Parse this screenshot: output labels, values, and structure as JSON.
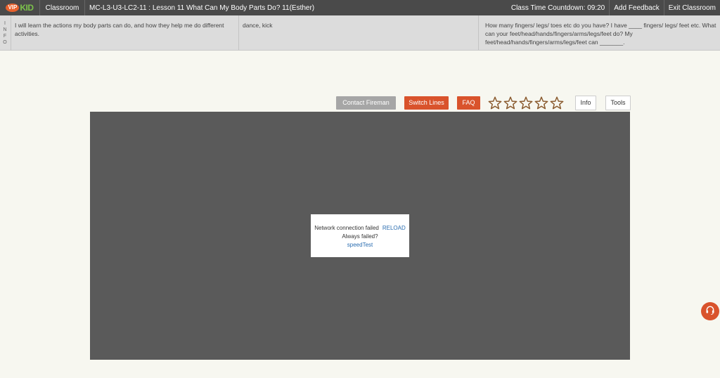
{
  "topbar": {
    "logo_vip": "VIP",
    "logo_kid": "KID",
    "classroom": "Classroom",
    "lesson": "MC-L3-U3-LC2-11 : Lesson 11 What Can My Body Parts Do? 11(Esther)",
    "countdown": "Class Time Countdown: 09:20",
    "add_feedback": "Add Feedback",
    "exit": "Exit Classroom"
  },
  "info": {
    "tab_letters": [
      "I",
      "N",
      "F",
      "O"
    ],
    "objective": "I will learn the actions my body parts can do, and how they help me do different activities.",
    "vocabulary": "dance, kick",
    "sentence": "How many fingers/ legs/ toes etc do you have? I have ____ fingers/ legs/ feet etc. What can your feet/head/hands/fingers/arms/legs/feet do? My feet/head/hands/fingers/arms/legs/feet can _______."
  },
  "controls": {
    "contact_fireman": "Contact Fireman",
    "switch_lines": "Switch Lines",
    "faq": "FAQ",
    "stars_total": 5,
    "stars_filled": 0,
    "info": "Info",
    "tools": "Tools"
  },
  "dialog": {
    "message": "Network connection failed",
    "reload": "RELOAD",
    "always_failed": "Always failed?",
    "speed_test": "speedTest"
  },
  "colors": {
    "accent": "#d9532c",
    "topbar": "#4a4a4a",
    "stage": "#5a5a5a",
    "link": "#2a6db0",
    "star_outline": "#8a5a2e"
  }
}
